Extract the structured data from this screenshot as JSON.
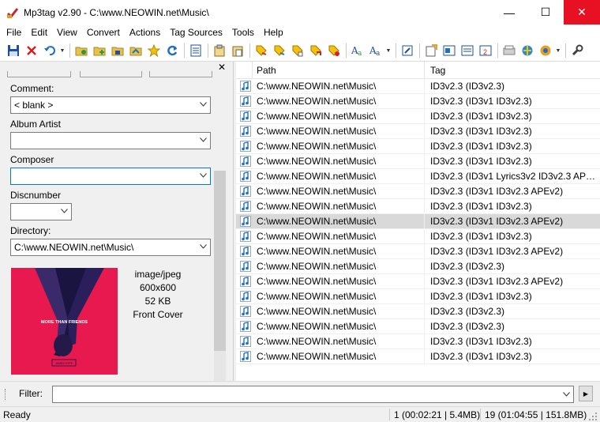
{
  "window": {
    "title": "Mp3tag v2.90  -  C:\\www.NEOWIN.net\\Music\\",
    "minimize": "—",
    "maximize": "☐",
    "close": "✕"
  },
  "menu": [
    "File",
    "Edit",
    "View",
    "Convert",
    "Actions",
    "Tag Sources",
    "Tools",
    "Help"
  ],
  "toolbar_icons": [
    "save-icon",
    "remove-tag-icon",
    "undo-icon",
    "change-directory-icon",
    "add-directory-icon",
    "save-playlist-icon",
    "open-folder-icon",
    "favorite-star-icon",
    "refresh-icon",
    "extended-tags-icon",
    "clipboard-copy-icon",
    "clipboard-paste-icon",
    "tag-filename-icon",
    "filename-tag-icon",
    "text-tag-icon",
    "tag-tag-icon",
    "autonumber-icon",
    "case-convert-icon",
    "case-convert-2-icon",
    "actions-icon",
    "export-icon",
    "playlist-icon",
    "filenames-list-icon",
    "discogs-icon",
    "musicbrainz-icon",
    "freedb-icon",
    "settings-wrench-icon"
  ],
  "panel": {
    "close": "✕",
    "comment": {
      "label": "Comment:",
      "value": "< blank >"
    },
    "album_artist": {
      "label": "Album Artist",
      "value": ""
    },
    "composer": {
      "label": "Composer",
      "value": ""
    },
    "discnumber": {
      "label": "Discnumber",
      "value": ""
    },
    "directory": {
      "label": "Directory:",
      "value": "C:\\www.NEOWIN.net\\Music\\"
    },
    "cover": {
      "mime": "image/jpeg",
      "size": "600x600",
      "filesize": "52 KB",
      "type": "Front Cover",
      "art_text": "MORE THAN FRIENDS",
      "art_subtext": "JAMES HYPE"
    }
  },
  "filelist": {
    "columns": {
      "path": "Path",
      "tag": "Tag"
    },
    "rows": [
      {
        "path": "C:\\www.NEOWIN.net\\Music\\",
        "tag": "ID3v2.3 (ID3v2.3)"
      },
      {
        "path": "C:\\www.NEOWIN.net\\Music\\",
        "tag": "ID3v2.3 (ID3v1 ID3v2.3)"
      },
      {
        "path": "C:\\www.NEOWIN.net\\Music\\",
        "tag": "ID3v2.3 (ID3v1 ID3v2.3)"
      },
      {
        "path": "C:\\www.NEOWIN.net\\Music\\",
        "tag": "ID3v2.3 (ID3v1 ID3v2.3)"
      },
      {
        "path": "C:\\www.NEOWIN.net\\Music\\",
        "tag": "ID3v2.3 (ID3v1 ID3v2.3)"
      },
      {
        "path": "C:\\www.NEOWIN.net\\Music\\",
        "tag": "ID3v2.3 (ID3v1 ID3v2.3)"
      },
      {
        "path": "C:\\www.NEOWIN.net\\Music\\",
        "tag": "ID3v2.3 (ID3v1 Lyrics3v2 ID3v2.3 APE..."
      },
      {
        "path": "C:\\www.NEOWIN.net\\Music\\",
        "tag": "ID3v2.3 (ID3v1 ID3v2.3 APEv2)"
      },
      {
        "path": "C:\\www.NEOWIN.net\\Music\\",
        "tag": "ID3v2.3 (ID3v1 ID3v2.3)"
      },
      {
        "path": "C:\\www.NEOWIN.net\\Music\\",
        "tag": "ID3v2.3 (ID3v1 ID3v2.3 APEv2)",
        "selected": true
      },
      {
        "path": "C:\\www.NEOWIN.net\\Music\\",
        "tag": "ID3v2.3 (ID3v1 ID3v2.3)"
      },
      {
        "path": "C:\\www.NEOWIN.net\\Music\\",
        "tag": "ID3v2.3 (ID3v1 ID3v2.3 APEv2)"
      },
      {
        "path": "C:\\www.NEOWIN.net\\Music\\",
        "tag": "ID3v2.3 (ID3v2.3)"
      },
      {
        "path": "C:\\www.NEOWIN.net\\Music\\",
        "tag": "ID3v2.3 (ID3v1 ID3v2.3 APEv2)"
      },
      {
        "path": "C:\\www.NEOWIN.net\\Music\\",
        "tag": "ID3v2.3 (ID3v1 ID3v2.3)"
      },
      {
        "path": "C:\\www.NEOWIN.net\\Music\\",
        "tag": "ID3v2.3 (ID3v2.3)"
      },
      {
        "path": "C:\\www.NEOWIN.net\\Music\\",
        "tag": "ID3v2.3 (ID3v2.3)"
      },
      {
        "path": "C:\\www.NEOWIN.net\\Music\\",
        "tag": "ID3v2.3 (ID3v1 ID3v2.3)"
      },
      {
        "path": "C:\\www.NEOWIN.net\\Music\\",
        "tag": "ID3v2.3 (ID3v1 ID3v2.3)"
      }
    ]
  },
  "filter": {
    "label": "Filter:",
    "value": "",
    "go": "▶"
  },
  "status": {
    "ready": "Ready",
    "selection": "1 (00:02:21 | 5.4MB)",
    "total": "19 (01:04:55 | 151.8MB)"
  },
  "colors": {
    "close_button": "#e81123",
    "selected_row": "#d9d9d9",
    "focus_border": "#0078d7",
    "cover_bg": "#e8194e",
    "icon_blue": "#1e6fc7"
  }
}
